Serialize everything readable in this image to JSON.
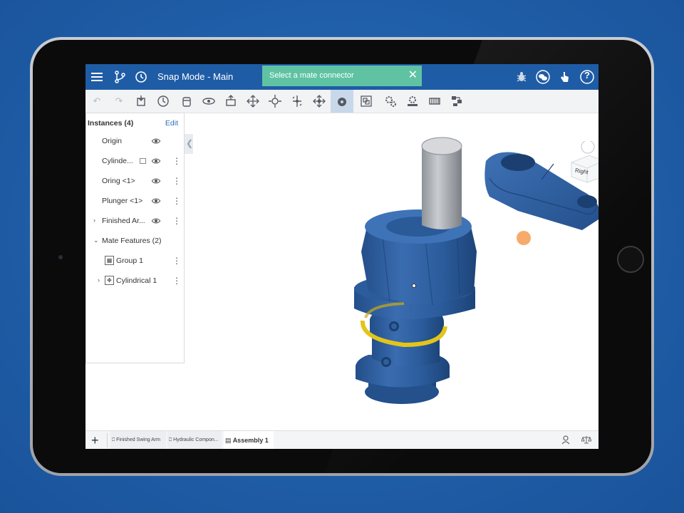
{
  "app": {
    "title": "Snap Mode - Main",
    "toast": "Select a mate connector",
    "colors": {
      "accent": "#1f5ca6",
      "toast": "#5fc3a3",
      "part_blue": "#2e5f9e",
      "oring": "#e3c51a",
      "mate_point": "#f5a25a"
    }
  },
  "topbar": {
    "left_icons": [
      "hamburger-menu-icon",
      "branch-icon",
      "history-icon"
    ],
    "right_icons": [
      "bug-icon",
      "chat-icon",
      "hand-pointer-icon",
      "help-icon"
    ],
    "help_label": "?"
  },
  "toolbar": {
    "tools": [
      "undo-icon",
      "redo-icon",
      "insert-icon",
      "named-positions-icon",
      "fastened-mate-icon",
      "revolute-mate-icon",
      "slider-mate-icon",
      "planar-mate-icon",
      "cylindrical-mate-icon",
      "pin-slot-mate-icon",
      "ball-mate-icon",
      "mate-connector-icon",
      "group-icon",
      "gear-relation-icon",
      "rack-relation-icon",
      "screw-relation-icon",
      "linear-relation-icon",
      "explode-icon"
    ]
  },
  "panel": {
    "header": "Instances (4)",
    "edit_label": "Edit",
    "rows": [
      {
        "label": "Origin",
        "eye": true,
        "dots": false,
        "indent": 1
      },
      {
        "label": "Cylinde...",
        "eye": true,
        "dots": true,
        "indent": 1,
        "badge": true
      },
      {
        "label": "Oring <1>",
        "eye": true,
        "dots": true,
        "indent": 1
      },
      {
        "label": "Plunger <1>",
        "eye": true,
        "dots": true,
        "indent": 1
      },
      {
        "label": "Finished Ar...",
        "eye": true,
        "dots": true,
        "indent": 1,
        "caret": "›"
      },
      {
        "label": "Mate Features (2)",
        "eye": false,
        "dots": false,
        "indent": 1,
        "caret": "⌄"
      },
      {
        "label": "Group 1",
        "eye": false,
        "dots": true,
        "indent": 2,
        "icon": "group-icon"
      },
      {
        "label": "Cylindrical 1",
        "eye": false,
        "dots": true,
        "indent": 2,
        "caret": "›",
        "icon": "cylindrical-mate-icon"
      }
    ]
  },
  "viewcube": {
    "face_label": "Right"
  },
  "bottombar": {
    "add_label": "+",
    "tabs": [
      {
        "label": "Finished Swing Arm",
        "active": false
      },
      {
        "label": "Hydraulic Compon...",
        "active": false
      },
      {
        "label": "Assembly 1",
        "active": true
      }
    ]
  }
}
